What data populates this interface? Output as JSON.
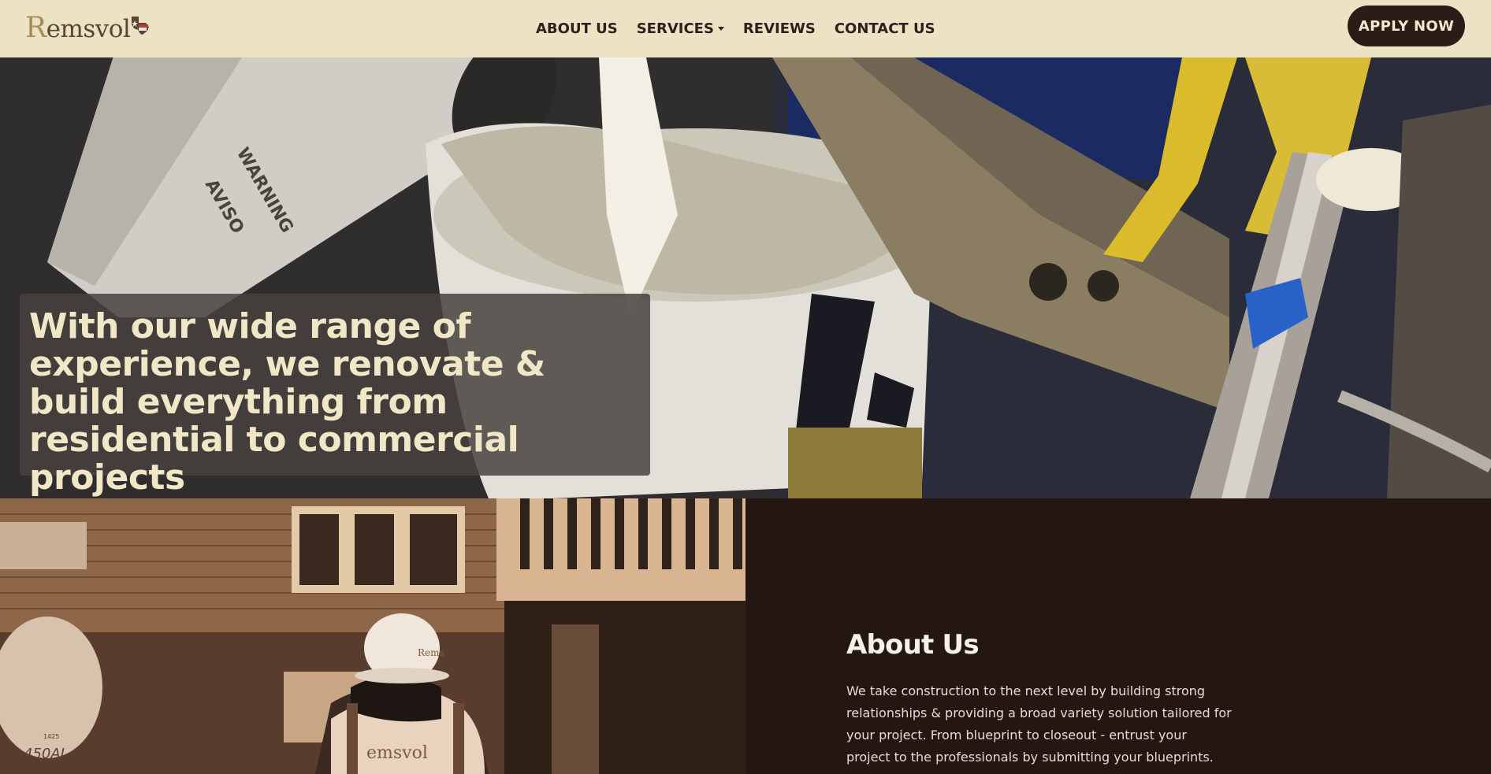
{
  "brand": {
    "name_initial": "R",
    "name_rest": "emsvol"
  },
  "nav": {
    "items": [
      {
        "label": "ABOUT US"
      },
      {
        "label": "SERVICES",
        "has_dropdown": true
      },
      {
        "label": "REVIEWS"
      },
      {
        "label": "CONTACT US"
      }
    ],
    "cta_label": "APPLY NOW"
  },
  "hero": {
    "headline": "With our wide range of experience, we renovate & build everything from residential to commercial projects"
  },
  "about": {
    "title": "About Us",
    "body": "We take construction to the next level by building strong relationships & providing a broad variety solution tailored for your project. From blueprint to closeout - entrust your project to the professionals by submitting your blueprints."
  },
  "colors": {
    "nav_bg": "#ece2c4",
    "dark_brown": "#2a1c17",
    "about_bg": "#231613",
    "headline_text": "#f1e6c6"
  },
  "images": {
    "hero_image": "paint sprayer pouring paint into bucket",
    "about_image": "worker in hard hat and safety vest in front of building",
    "helmet_text": "Rems",
    "vest_text": "emsvol",
    "truck_plate": "450AJ",
    "truck_number": "1425"
  }
}
